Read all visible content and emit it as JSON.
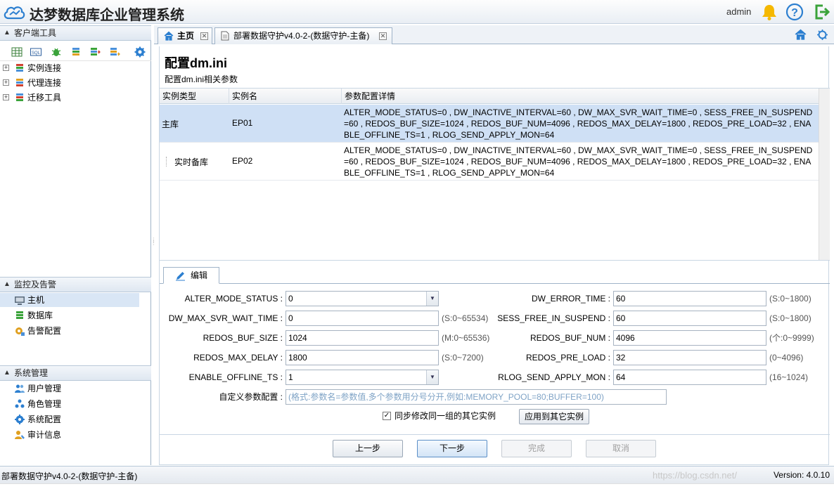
{
  "app": {
    "title": "达梦数据库企业管理系统",
    "user": "admin"
  },
  "sidebar": {
    "client_tools": {
      "title": "客户端工具",
      "toolbar_icons": [
        "table-icon",
        "sql-icon",
        "bug-icon",
        "db-stack-icon",
        "db-export-icon",
        "db-import-icon",
        "settings-icon"
      ],
      "items": [
        {
          "label": "实例连接"
        },
        {
          "label": "代理连接"
        },
        {
          "label": "迁移工具"
        }
      ]
    },
    "monitor": {
      "title": "监控及告警",
      "items": [
        {
          "label": "主机",
          "selected": true
        },
        {
          "label": "数据库"
        },
        {
          "label": "告警配置"
        }
      ]
    },
    "system": {
      "title": "系统管理",
      "items": [
        {
          "label": "用户管理"
        },
        {
          "label": "角色管理"
        },
        {
          "label": "系统配置"
        },
        {
          "label": "审计信息"
        }
      ]
    }
  },
  "tabs": [
    {
      "label": "主页"
    },
    {
      "label": "部署数据守护v4.0-2-(数据守护-主备)"
    }
  ],
  "page": {
    "title": "配置dm.ini",
    "subtitle": "配置dm.ini相关参数"
  },
  "grid": {
    "columns": [
      "实例类型",
      "实例名",
      "参数配置详情"
    ],
    "rows": [
      {
        "type": "主库",
        "name": "EP01",
        "detail": "ALTER_MODE_STATUS=0 , DW_INACTIVE_INTERVAL=60 , DW_MAX_SVR_WAIT_TIME=0 , SESS_FREE_IN_SUSPEND=60 , REDOS_BUF_SIZE=1024 , REDOS_BUF_NUM=4096 , REDOS_MAX_DELAY=1800 , REDOS_PRE_LOAD=32 , ENABLE_OFFLINE_TS=1 , RLOG_SEND_APPLY_MON=64",
        "selected": true
      },
      {
        "type": "实时备库",
        "name": "EP02",
        "detail": "ALTER_MODE_STATUS=0 , DW_INACTIVE_INTERVAL=60 , DW_MAX_SVR_WAIT_TIME=0 , SESS_FREE_IN_SUSPEND=60 , REDOS_BUF_SIZE=1024 , REDOS_BUF_NUM=4096 , REDOS_MAX_DELAY=1800 , REDOS_PRE_LOAD=32 , ENABLE_OFFLINE_TS=1 , RLOG_SEND_APPLY_MON=64",
        "selected": false
      }
    ]
  },
  "edit": {
    "tab_label": "编辑",
    "fields": {
      "alter_mode_status": {
        "label": "ALTER_MODE_STATUS :",
        "value": "0"
      },
      "dw_error_time": {
        "label": "DW_ERROR_TIME :",
        "value": "60",
        "hint": "(S:0~1800)"
      },
      "dw_max_svr_wait_time": {
        "label": "DW_MAX_SVR_WAIT_TIME :",
        "value": "0",
        "hint": "(S:0~65534)"
      },
      "sess_free_in_suspend": {
        "label": "SESS_FREE_IN_SUSPEND :",
        "value": "60",
        "hint": "(S:0~1800)"
      },
      "redos_buf_size": {
        "label": "REDOS_BUF_SIZE :",
        "value": "1024",
        "hint": "(M:0~65536)"
      },
      "redos_buf_num": {
        "label": "REDOS_BUF_NUM :",
        "value": "4096",
        "hint": "(个:0~9999)"
      },
      "redos_max_delay": {
        "label": "REDOS_MAX_DELAY :",
        "value": "1800",
        "hint": "(S:0~7200)"
      },
      "redos_pre_load": {
        "label": "REDOS_PRE_LOAD :",
        "value": "32",
        "hint": "(0~4096)"
      },
      "enable_offline_ts": {
        "label": "ENABLE_OFFLINE_TS :",
        "value": "1"
      },
      "rlog_send_apply_mon": {
        "label": "RLOG_SEND_APPLY_MON :",
        "value": "64",
        "hint": "(16~1024)"
      },
      "custom_params": {
        "label": "自定义参数配置 :",
        "placeholder": "(格式:参数名=参数值,多个参数用分号分开,例如:MEMORY_POOL=80;BUFFER=100)"
      }
    },
    "sync_checkbox": {
      "label": "同步修改同一组的其它实例",
      "checked": true
    },
    "apply_button": "应用到其它实例"
  },
  "wizard": {
    "prev": "上一步",
    "next": "下一步",
    "finish": "完成",
    "cancel": "取消"
  },
  "status": {
    "left": "部署数据守护v4.0-2-(数据守护-主备)",
    "watermark": "https://blog.csdn.net/",
    "version": "Version: 4.0.10"
  },
  "colors": {
    "accent": "#2c7fd0",
    "selected_row": "#cfe0f5",
    "bell": "#f5b800",
    "exit": "#3aa33a"
  }
}
